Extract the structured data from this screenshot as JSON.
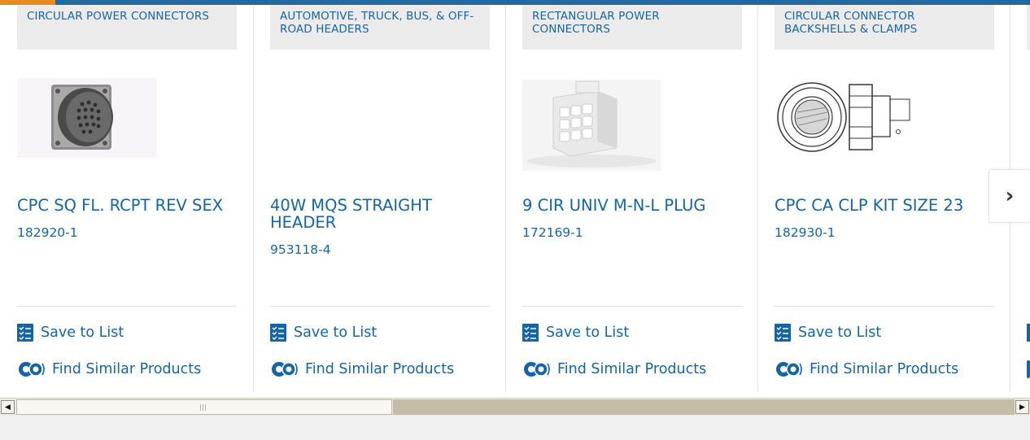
{
  "accent_colors": {
    "link": "#1565a6",
    "top_bar": "#1f6aa5",
    "top_bar_accent": "#e98a1c"
  },
  "products": [
    {
      "category": "CIRCULAR POWER CONNECTORS",
      "name": "CPC SQ FL. RCPT REV SEX",
      "part_number": "182920-1",
      "image": "circular-connector-photo",
      "save_label": "Save to List",
      "similar_label": "Find Similar Products"
    },
    {
      "category": "AUTOMOTIVE, TRUCK, BUS, & OFF-ROAD HEADERS",
      "name": "40W MQS STRAIGHT HEADER",
      "part_number": "953118-4",
      "image": "none",
      "save_label": "Save to List",
      "similar_label": "Find Similar Products"
    },
    {
      "category": "RECTANGULAR POWER CONNECTORS",
      "name": "9 CIR UNIV M-N-L PLUG",
      "part_number": "172169-1",
      "image": "rectangular-plug-photo",
      "save_label": "Save to List",
      "similar_label": "Find Similar Products"
    },
    {
      "category": "CIRCULAR CONNECTOR BACKSHELLS & CLAMPS",
      "name": "CPC CA CLP KIT SIZE 23",
      "part_number": "182930-1",
      "image": "backshell-line-drawing",
      "save_label": "Save to List",
      "similar_label": "Find Similar Products"
    }
  ],
  "carousel": {
    "next_icon": "chevron-right-icon",
    "next_glyph": "›"
  },
  "scrollbar": {
    "left_glyph": "◀",
    "right_glyph": "▶"
  }
}
